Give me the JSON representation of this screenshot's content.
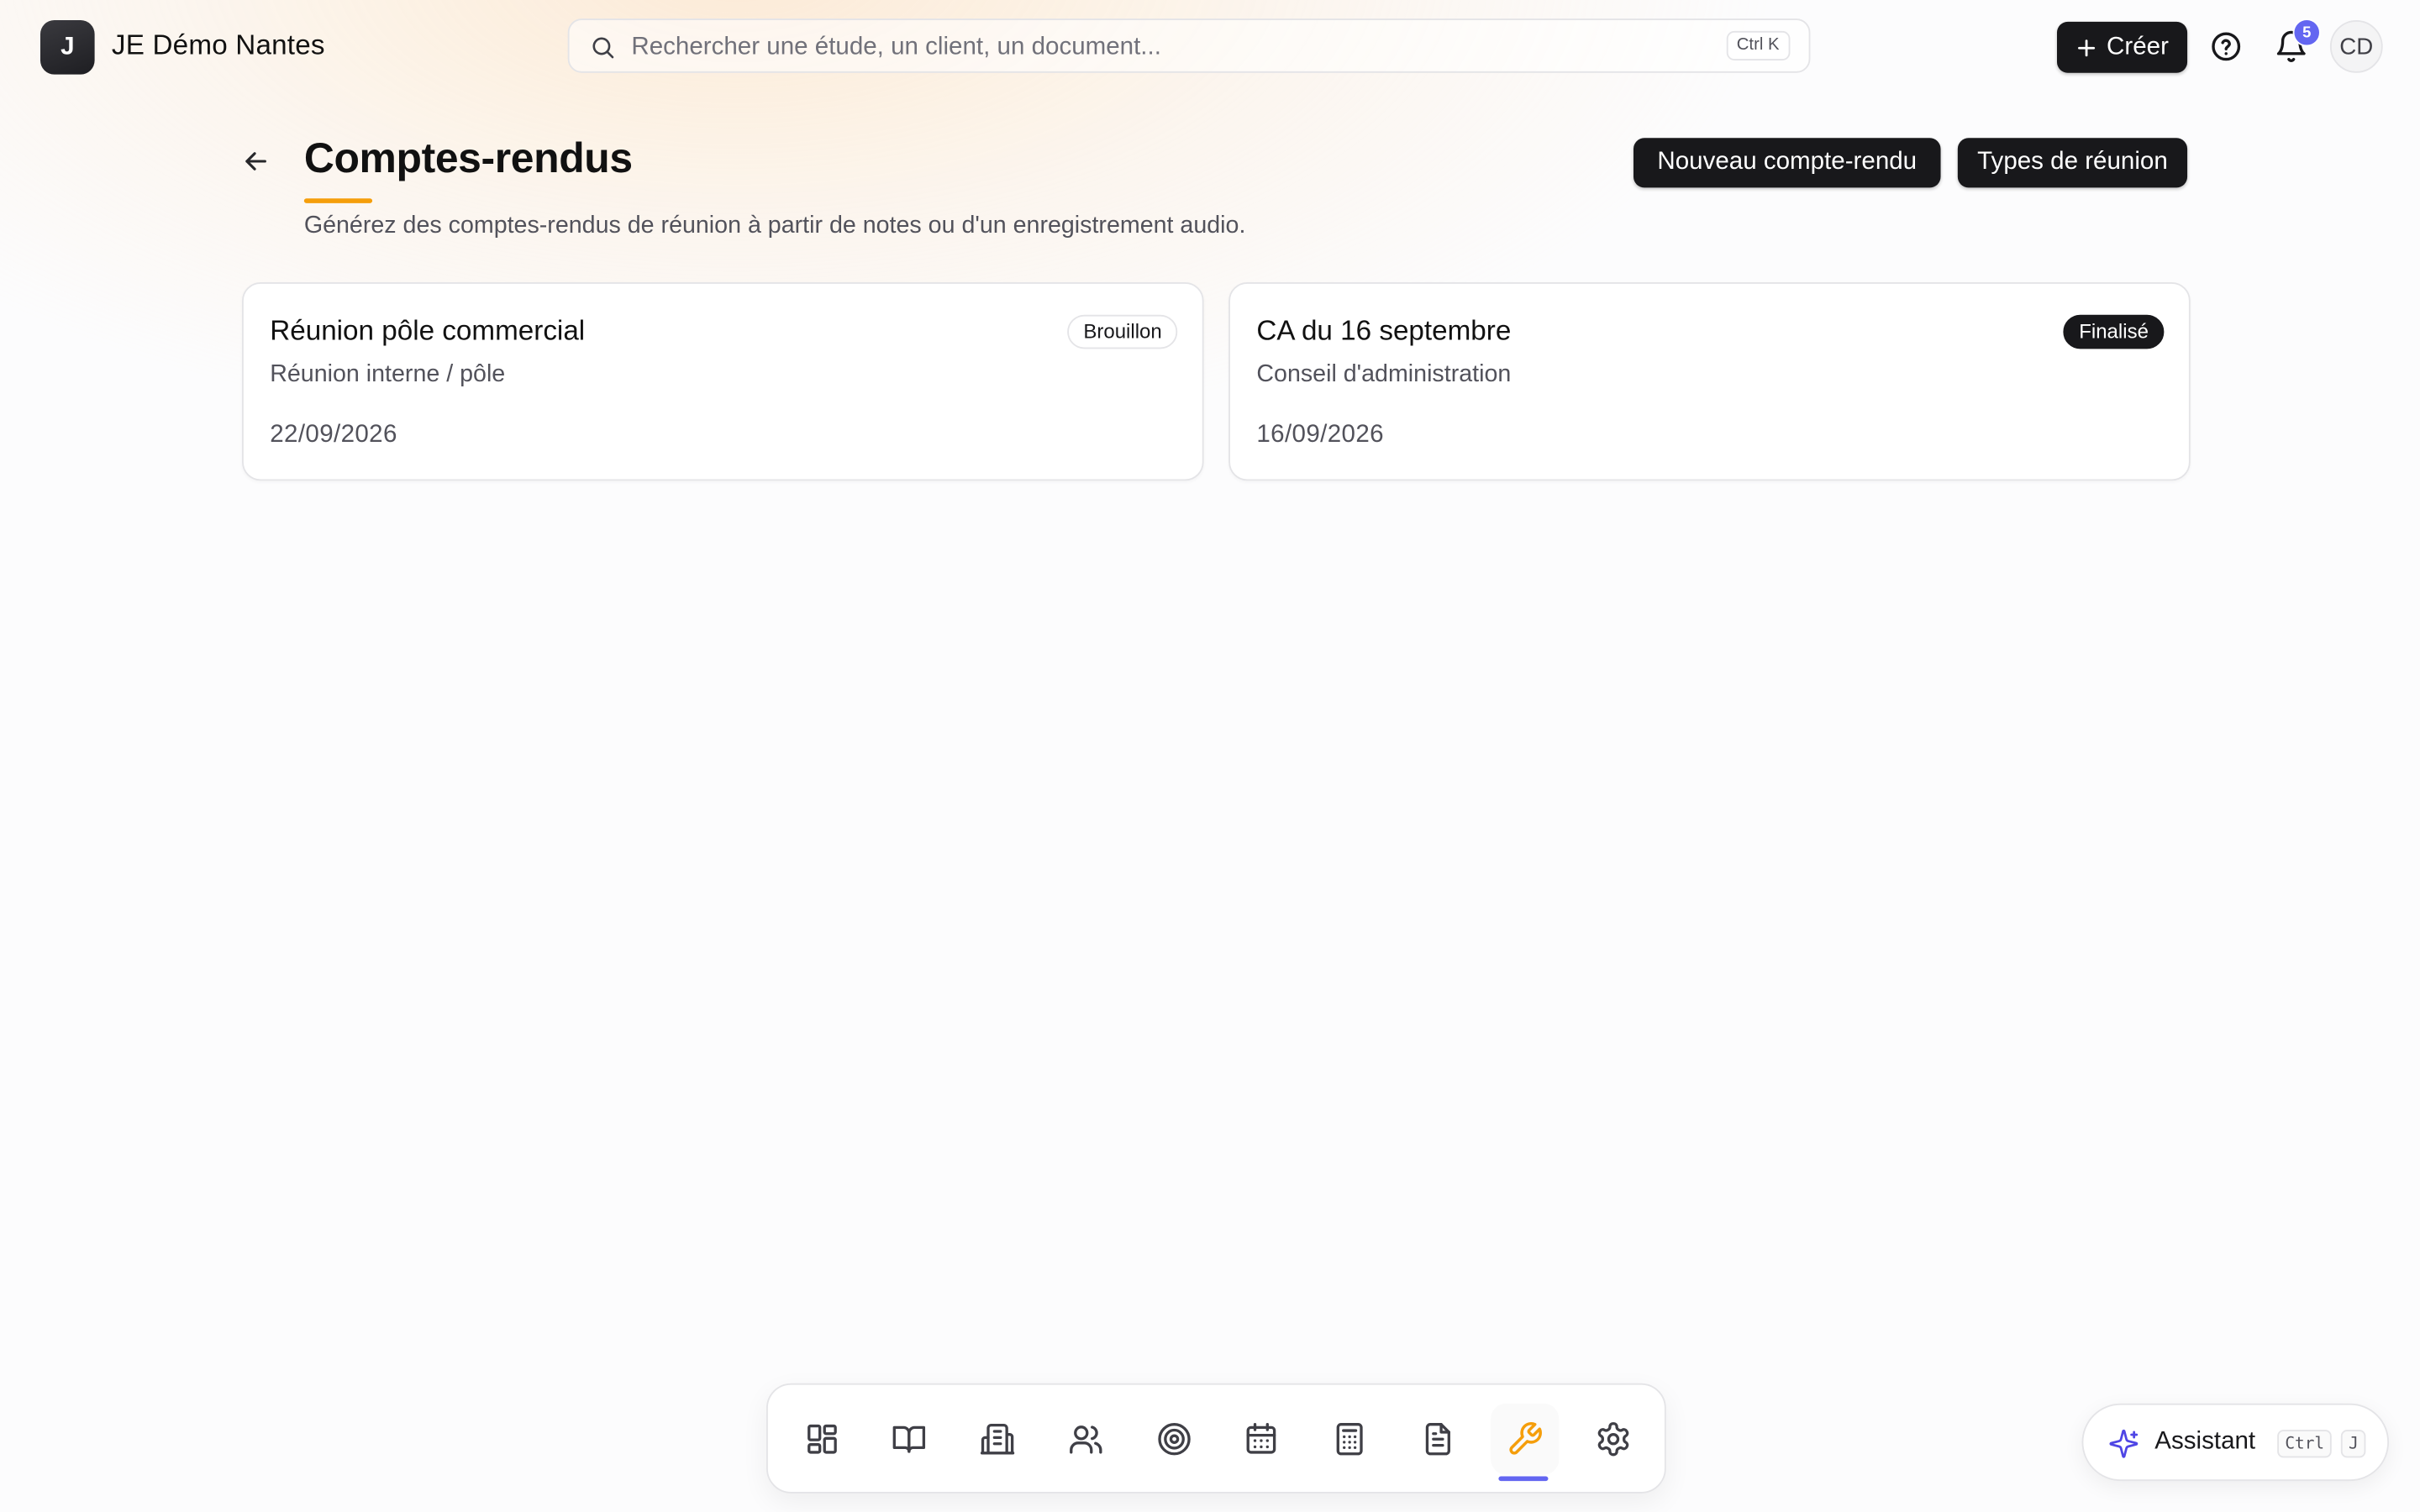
{
  "org": {
    "logo_letter": "J",
    "name": "JE Démo Nantes"
  },
  "search": {
    "placeholder": "Rechercher une étude, un client, un document...",
    "shortcut": "Ctrl K"
  },
  "topbar": {
    "create_label": "Créer",
    "notification_count": "5",
    "avatar_initials": "CD"
  },
  "header": {
    "title": "Comptes-rendus",
    "subtitle": "Générez des comptes-rendus de réunion à partir de notes ou d'un enregistrement audio.",
    "new_button": "Nouveau compte-rendu",
    "types_button": "Types de réunion"
  },
  "reports": [
    {
      "title": "Réunion pôle commercial",
      "type": "Réunion interne / pôle",
      "date": "22/09/2026",
      "status": "Brouillon"
    },
    {
      "title": "CA du 16 septembre",
      "type": "Conseil d'administration",
      "date": "16/09/2026",
      "status": "Finalisé"
    }
  ],
  "dock": {
    "items": [
      "grid-icon",
      "book-icon",
      "building-icon",
      "users-icon",
      "target-icon",
      "calendar-icon",
      "calculator-icon",
      "document-icon",
      "wrench-icon",
      "gear-icon"
    ],
    "active": "wrench-icon"
  },
  "assistant": {
    "label": "Assistant",
    "shortcut_keys": [
      "Ctrl",
      "J"
    ]
  },
  "colors": {
    "accent_orange": "#f59e0b",
    "accent_indigo": "#6366f1",
    "dark": "#18181b"
  }
}
